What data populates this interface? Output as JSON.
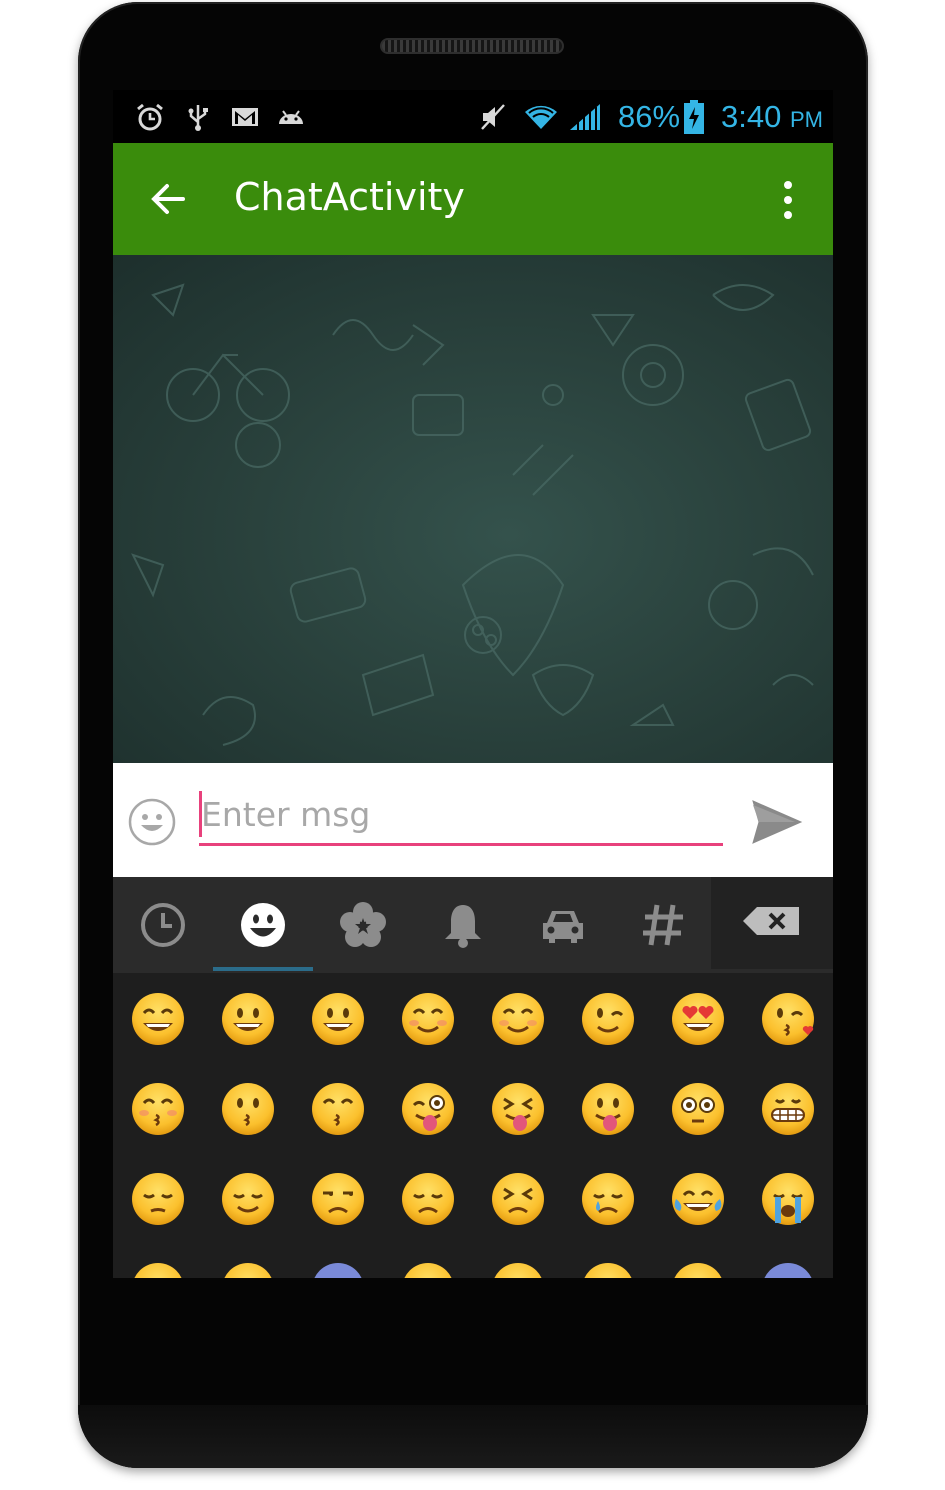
{
  "status_bar": {
    "icons_left": [
      "alarm-icon",
      "usb-icon",
      "gmail-icon",
      "android-icon"
    ],
    "icons_right": [
      "mute-icon",
      "wifi-icon",
      "signal-icon"
    ],
    "battery_percent": "86%",
    "battery_icon": "battery-charging-icon",
    "time": "3:40",
    "ampm": "PM"
  },
  "app_bar": {
    "title": "ChatActivity",
    "back_icon": "arrow-back-icon",
    "overflow_icon": "more-vert-icon",
    "color": "#3a8c0c"
  },
  "input": {
    "placeholder": "Enter msg",
    "value": "",
    "emoji_icon": "smiley-icon",
    "send_icon": "send-icon",
    "accent": "#e8417c"
  },
  "emoji_panel": {
    "categories": [
      "recent",
      "people",
      "nature",
      "objects",
      "places",
      "symbols"
    ],
    "selected_category": "people",
    "backspace_icon": "backspace-icon",
    "grid": [
      [
        "grinning",
        "smiley",
        "grin",
        "blush",
        "relaxed",
        "wink",
        "heart-eyes",
        "kissing-heart"
      ],
      [
        "kissing-closed-eyes",
        "kissing",
        "kissing-smiling-eyes",
        "stuck-out-tongue-winking-eye",
        "stuck-out-tongue-closed-eyes",
        "stuck-out-tongue",
        "flushed",
        "grimacing"
      ],
      [
        "pensive",
        "relieved",
        "unamused",
        "disappointed",
        "persevere",
        "cry",
        "joy",
        "sob"
      ],
      [
        "sleepy",
        "disappointed-relieved",
        "cold-sweat",
        "sweat-smile",
        "sweat",
        "weary",
        "tired",
        "fearful"
      ]
    ]
  },
  "nav_bar": {
    "back": "nav-back-icon",
    "home": "nav-home-icon",
    "recents": "nav-recents-icon"
  }
}
